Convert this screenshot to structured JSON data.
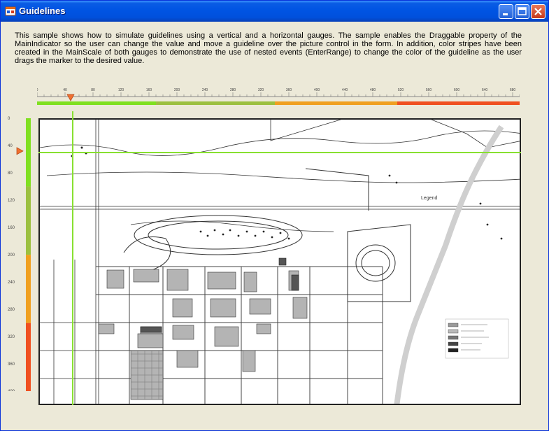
{
  "window": {
    "title": "Guidelines",
    "icon": "app-form-icon",
    "buttons": [
      "minimize-icon",
      "maximize-icon",
      "close-icon"
    ]
  },
  "description": "This sample shows how to simulate guidelines using a vertical and a horizontal gauges. The sample enables the Draggable property of the MainIndicator so the user can change the value and move a guideline over the picture control in the form. In addition, color stripes have been created in the MainScale of both gauges  to demonstrate the use of nested events (EnterRange) to change the color of the guideline as the user drags the marker to the desired value.",
  "horizontal_gauge": {
    "tick_labels": [
      "0",
      "40",
      "80",
      "120",
      "160",
      "200",
      "240",
      "280",
      "320",
      "360",
      "400",
      "440",
      "480",
      "520",
      "560",
      "600",
      "640",
      "680"
    ],
    "min": 0,
    "max": 690,
    "value": 48,
    "stripes": [
      {
        "from": 0,
        "to": 170,
        "color": "#80e020"
      },
      {
        "from": 170,
        "to": 340,
        "color": "#9cc040"
      },
      {
        "from": 340,
        "to": 515,
        "color": "#f0a020"
      },
      {
        "from": 515,
        "to": 690,
        "color": "#f05020"
      }
    ]
  },
  "vertical_gauge": {
    "tick_labels": [
      "0",
      "40",
      "80",
      "120",
      "160",
      "200",
      "240",
      "280",
      "320",
      "360",
      "400"
    ],
    "min": 0,
    "max": 410,
    "value": 48,
    "stripes": [
      {
        "from": 0,
        "to": 100,
        "color": "#80e020"
      },
      {
        "from": 100,
        "to": 200,
        "color": "#9cc040"
      },
      {
        "from": 200,
        "to": 300,
        "color": "#f0a020"
      },
      {
        "from": 300,
        "to": 410,
        "color": "#f05020"
      }
    ]
  },
  "guideline_color": "#88e030",
  "map": {
    "legend_title": "Legend",
    "legend_entries": [
      "",
      "",
      "",
      "",
      ""
    ]
  }
}
